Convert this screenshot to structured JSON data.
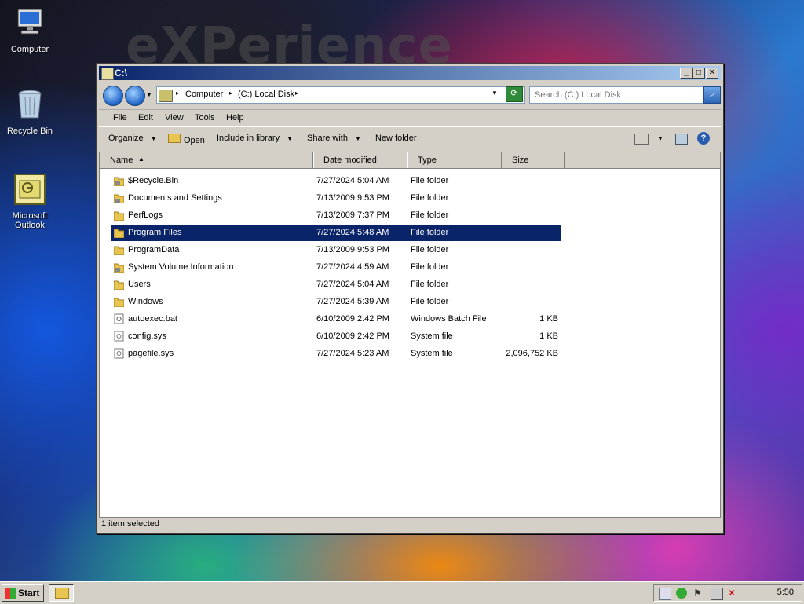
{
  "wallpaper": {
    "text": "eXPerience"
  },
  "desktop": {
    "icons": [
      {
        "label": "Computer"
      },
      {
        "label": "Recycle Bin"
      },
      {
        "label": "Microsoft Outlook"
      }
    ]
  },
  "window": {
    "title": "C:\\",
    "address": {
      "segments": [
        "Computer",
        "(C:) Local Disk"
      ]
    },
    "search_placeholder": "Search (C:) Local Disk",
    "menu": [
      "File",
      "Edit",
      "View",
      "Tools",
      "Help"
    ],
    "commands": [
      "Organize",
      "Open",
      "Include in library",
      "Share with",
      "New folder"
    ],
    "columns": [
      "Name",
      "Date modified",
      "Type",
      "Size"
    ],
    "files": [
      {
        "name": "$Recycle.Bin",
        "date": "7/27/2024 5:04 AM",
        "type": "File folder",
        "size": "",
        "icon": "locked-folder-icon"
      },
      {
        "name": "Documents and Settings",
        "date": "7/13/2009 9:53 PM",
        "type": "File folder",
        "size": "",
        "icon": "locked-folder-icon"
      },
      {
        "name": "PerfLogs",
        "date": "7/13/2009 7:37 PM",
        "type": "File folder",
        "size": "",
        "icon": "folder-icon"
      },
      {
        "name": "Program Files",
        "date": "7/27/2024 5:48 AM",
        "type": "File folder",
        "size": "",
        "icon": "folder-icon",
        "selected": true
      },
      {
        "name": "ProgramData",
        "date": "7/13/2009 9:53 PM",
        "type": "File folder",
        "size": "",
        "icon": "folder-icon"
      },
      {
        "name": "System Volume Information",
        "date": "7/27/2024 4:59 AM",
        "type": "File folder",
        "size": "",
        "icon": "locked-folder-icon"
      },
      {
        "name": "Users",
        "date": "7/27/2024 5:04 AM",
        "type": "File folder",
        "size": "",
        "icon": "folder-icon"
      },
      {
        "name": "Windows",
        "date": "7/27/2024 5:39 AM",
        "type": "File folder",
        "size": "",
        "icon": "folder-icon"
      },
      {
        "name": "autoexec.bat",
        "date": "6/10/2009 2:42 PM",
        "type": "Windows Batch File",
        "size": "1 KB",
        "icon": "batch-file-icon"
      },
      {
        "name": "config.sys",
        "date": "6/10/2009 2:42 PM",
        "type": "System file",
        "size": "1 KB",
        "icon": "system-file-icon"
      },
      {
        "name": "pagefile.sys",
        "date": "7/27/2024 5:23 AM",
        "type": "System file",
        "size": "2,096,752 KB",
        "icon": "system-file-icon"
      }
    ],
    "status": "1 item selected"
  },
  "taskbar": {
    "start_label": "Start",
    "clock": "5:50"
  },
  "colors": {
    "selection": "#0a246a",
    "titlebar": "#0a246a",
    "chrome": "#d4d0c8"
  }
}
